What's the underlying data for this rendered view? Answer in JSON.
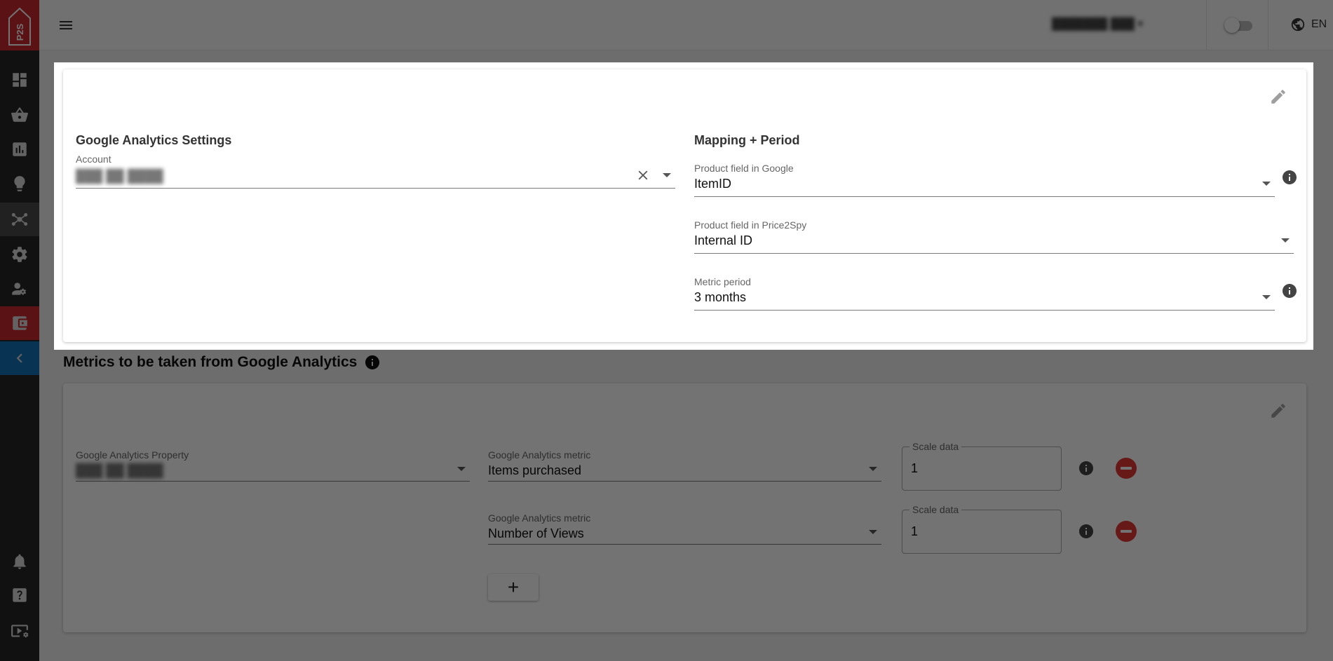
{
  "app": {
    "logo_text": "P2S",
    "brand_color": "#c8282e",
    "active_color": "#1572b5"
  },
  "sidebar": {
    "items": [
      {
        "name": "dashboard-icon"
      },
      {
        "name": "basket-icon"
      },
      {
        "name": "bar-chart-icon"
      },
      {
        "name": "lightbulb-icon"
      },
      {
        "name": "integrations-icon"
      },
      {
        "name": "settings-gear-icon"
      },
      {
        "name": "user-settings-icon"
      },
      {
        "name": "wallet-icon"
      },
      {
        "name": "collapse-chevron-icon"
      },
      {
        "name": "bell-icon"
      },
      {
        "name": "help-icon"
      },
      {
        "name": "video-settings-icon"
      }
    ]
  },
  "topbar": {
    "user_label": "███████ ███ ▾",
    "language": "EN"
  },
  "ga_settings": {
    "title": "Google Analytics Settings",
    "account_label": "Account",
    "account_value": "███ ██ ████"
  },
  "mapping": {
    "title": "Mapping + Period",
    "google_field_label": "Product field in Google",
    "google_field_value": "ItemID",
    "p2s_field_label": "Product field in Price2Spy",
    "p2s_field_value": "Internal ID",
    "metric_period_label": "Metric period",
    "metric_period_value": "3 months"
  },
  "metrics": {
    "title": "Metrics to be taken from Google Analytics",
    "property_label": "Google Analytics Property",
    "property_value": "███ ██ ████",
    "rows": [
      {
        "metric_label": "Google Analytics metric",
        "metric_value": "Items purchased",
        "scale_label": "Scale data",
        "scale_value": "1"
      },
      {
        "metric_label": "Google Analytics metric",
        "metric_value": "Number of Views",
        "scale_label": "Scale data",
        "scale_value": "1"
      }
    ],
    "add_label": "+"
  }
}
